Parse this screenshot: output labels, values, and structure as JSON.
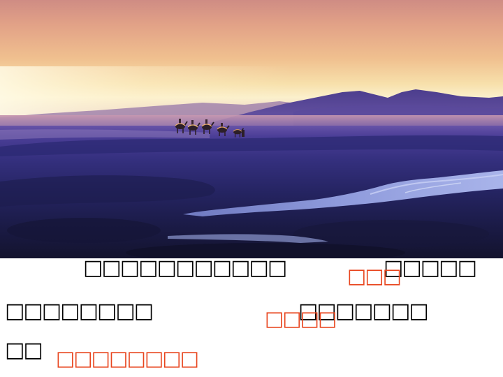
{
  "slide": {
    "line1": {
      "left": "□□□□□□□□□□□",
      "right": "□□□□□"
    },
    "line2": {
      "left": "□□□□□□□□",
      "right": "□□□□□□□"
    },
    "line3": {
      "left": "□□"
    },
    "answers": [
      "□□□",
      "□□□□",
      "□□□□□□□□"
    ]
  },
  "colors": {
    "text": "#000000",
    "answer": "#e8451e",
    "background": "#ffffff"
  }
}
